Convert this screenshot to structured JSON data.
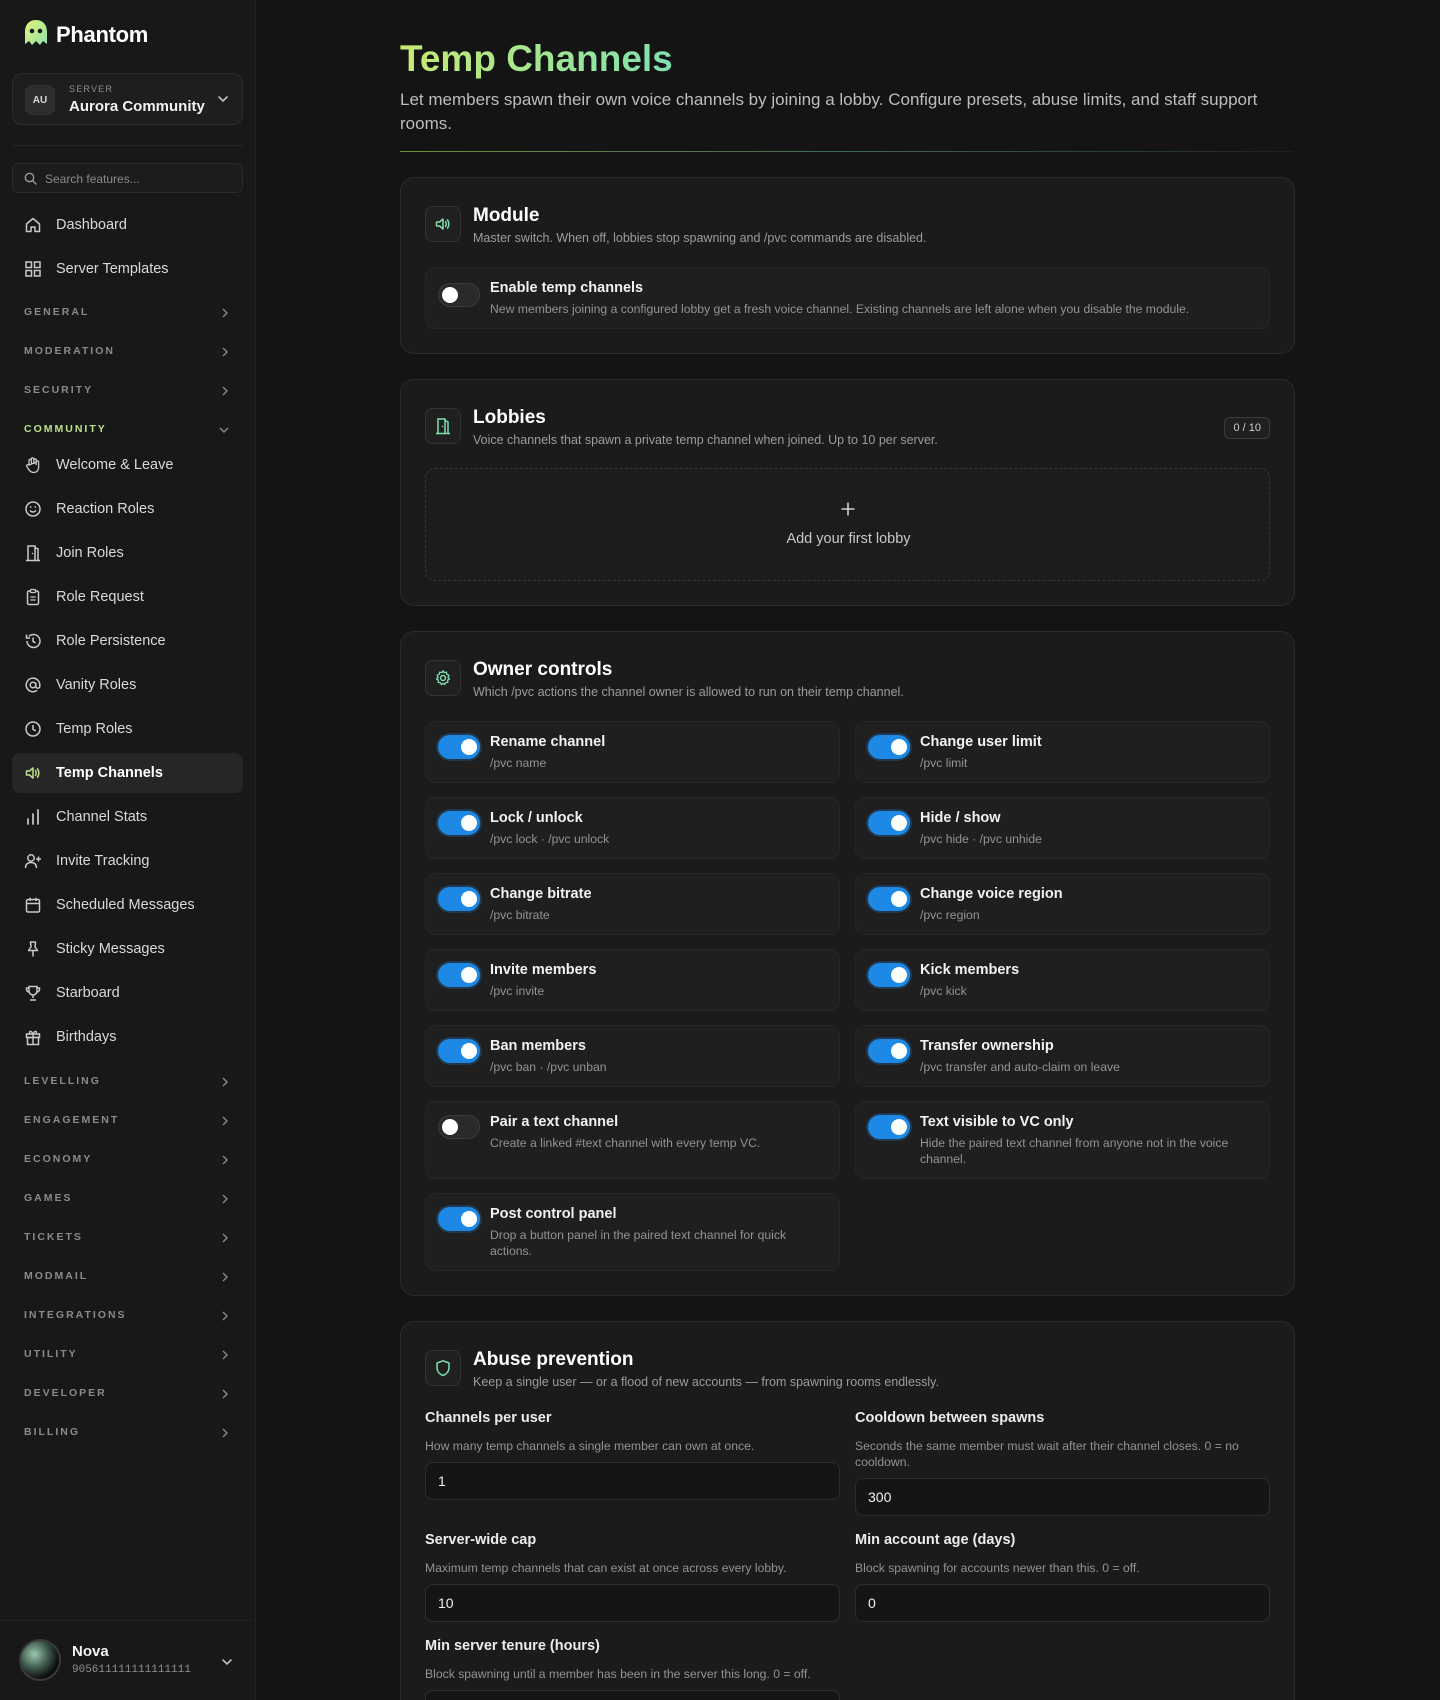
{
  "brand": {
    "name": "Phantom",
    "logo_icon": "ghost-icon",
    "accent": "#bde08a"
  },
  "server": {
    "avatar": "AU",
    "caption": "SERVER",
    "name": "Aurora Community"
  },
  "search": {
    "placeholder": "Search features..."
  },
  "nav": {
    "dashboard": "Dashboard",
    "server_templates": "Server Templates",
    "sections": {
      "general": "GENERAL",
      "moderation": "MODERATION",
      "security": "SECURITY",
      "community": "COMMUNITY",
      "levelling": "LEVELLING",
      "engagement": "ENGAGEMENT",
      "economy": "ECONOMY",
      "games": "GAMES",
      "tickets": "TICKETS",
      "modmail": "MODMAIL",
      "integrations": "INTEGRATIONS",
      "utility": "UTILITY",
      "developer": "DEVELOPER",
      "billing": "BILLING"
    },
    "community_items": [
      {
        "label": "Welcome & Leave",
        "icon": "hand-wave-icon"
      },
      {
        "label": "Reaction Roles",
        "icon": "smile-icon"
      },
      {
        "label": "Join Roles",
        "icon": "door-icon"
      },
      {
        "label": "Role Request",
        "icon": "clipboard-icon"
      },
      {
        "label": "Role Persistence",
        "icon": "history-icon"
      },
      {
        "label": "Vanity Roles",
        "icon": "at-sign-icon"
      },
      {
        "label": "Temp Roles",
        "icon": "clock-icon"
      },
      {
        "label": "Temp Channels",
        "icon": "speaker-icon",
        "active": true
      },
      {
        "label": "Channel Stats",
        "icon": "bar-chart-icon"
      },
      {
        "label": "Invite Tracking",
        "icon": "user-plus-icon"
      },
      {
        "label": "Scheduled Messages",
        "icon": "calendar-icon"
      },
      {
        "label": "Sticky Messages",
        "icon": "pin-icon"
      },
      {
        "label": "Starboard",
        "icon": "trophy-icon"
      },
      {
        "label": "Birthdays",
        "icon": "gift-icon"
      }
    ]
  },
  "user": {
    "name": "Nova",
    "id": "905611111111111111"
  },
  "page": {
    "title": "Temp Channels",
    "subtitle": "Let members spawn their own voice channels by joining a lobby. Configure presets, abuse limits, and staff support rooms."
  },
  "module": {
    "title": "Module",
    "desc": "Master switch. When off, lobbies stop spawning and /pvc commands are disabled.",
    "toggle_title": "Enable temp channels",
    "toggle_desc": "New members joining a configured lobby get a fresh voice channel. Existing channels are left alone when you disable the module.",
    "enabled": false
  },
  "lobbies": {
    "title": "Lobbies",
    "desc": "Voice channels that spawn a private temp channel when joined. Up to 10 per server.",
    "count": "0 / 10",
    "add_label": "Add your first lobby"
  },
  "owner_controls": {
    "title": "Owner controls",
    "desc": "Which /pvc actions the channel owner is allowed to run on their temp channel.",
    "options": [
      {
        "title": "Rename channel",
        "sub": "/pvc name",
        "on": true
      },
      {
        "title": "Change user limit",
        "sub": "/pvc limit",
        "on": true
      },
      {
        "title": "Lock / unlock",
        "sub": "/pvc lock · /pvc unlock",
        "on": true
      },
      {
        "title": "Hide / show",
        "sub": "/pvc hide · /pvc unhide",
        "on": true
      },
      {
        "title": "Change bitrate",
        "sub": "/pvc bitrate",
        "on": true
      },
      {
        "title": "Change voice region",
        "sub": "/pvc region",
        "on": true
      },
      {
        "title": "Invite members",
        "sub": "/pvc invite",
        "on": true
      },
      {
        "title": "Kick members",
        "sub": "/pvc kick",
        "on": true
      },
      {
        "title": "Ban members",
        "sub": "/pvc ban · /pvc unban",
        "on": true
      },
      {
        "title": "Transfer ownership",
        "sub": "/pvc transfer and auto-claim on leave",
        "on": true
      },
      {
        "title": "Pair a text channel",
        "sub": "Create a linked #text channel with every temp VC.",
        "on": false
      },
      {
        "title": "Text visible to VC only",
        "sub": "Hide the paired text channel from anyone not in the voice channel.",
        "on": true
      },
      {
        "title": "Post control panel",
        "sub": "Drop a button panel in the paired text channel for quick actions.",
        "on": true
      }
    ]
  },
  "abuse": {
    "title": "Abuse prevention",
    "desc": "Keep a single user — or a flood of new accounts — from spawning rooms endlessly.",
    "fields": [
      {
        "label": "Channels per user",
        "help": "How many temp channels a single member can own at once.",
        "value": "1"
      },
      {
        "label": "Cooldown between spawns",
        "help": "Seconds the same member must wait after their channel closes. 0 = no cooldown.",
        "value": "300"
      },
      {
        "label": "Server-wide cap",
        "help": "Maximum temp channels that can exist at once across every lobby.",
        "value": "10"
      },
      {
        "label": "Min account age (days)",
        "help": "Block spawning for accounts newer than this. 0 = off.",
        "value": "0"
      },
      {
        "label": "Min server tenure (hours)",
        "help": "Block spawning until a member has been in the server this long. 0 = off.",
        "value": ""
      }
    ]
  },
  "colors": {
    "toggle_on": "#1e88e5",
    "title_gradient_start": "#c8ea72",
    "title_gradient_end": "#7fe0b0"
  }
}
